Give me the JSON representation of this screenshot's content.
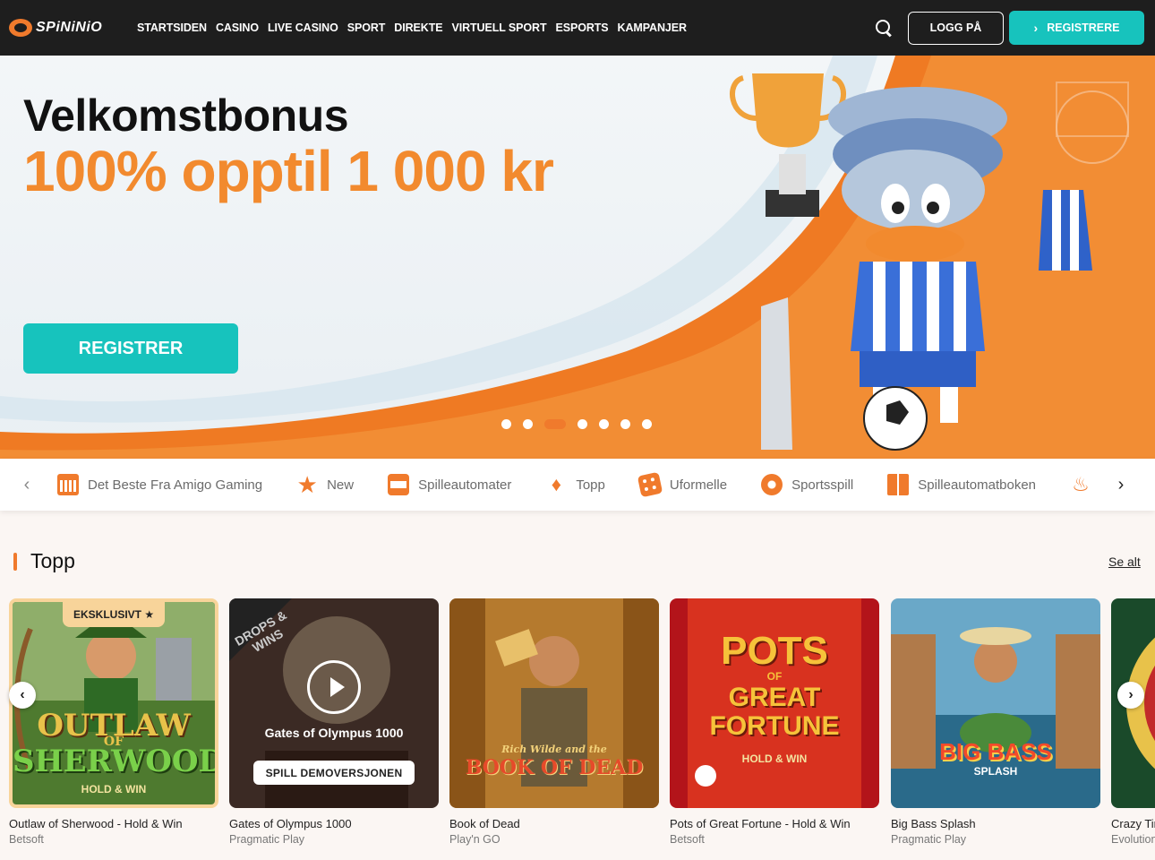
{
  "header": {
    "logo_text": "SPiNiNiO",
    "nav": [
      "STARTSIDEN",
      "CASINO",
      "LIVE CASINO",
      "SPORT",
      "DIREKTE",
      "VIRTUELL SPORT",
      "ESPORTS",
      "KAMPANJER"
    ],
    "login_label": "LOGG PÅ",
    "register_label": "REGISTRERE",
    "register_icon": "chevron-right-icon",
    "search_icon": "search-icon"
  },
  "hero": {
    "title": "Velkomstbonus",
    "subtitle": "100% opptil 1 000 kr",
    "cta_label": "REGISTRER",
    "slide_count": 7,
    "active_slide": 3
  },
  "categories": {
    "items": [
      {
        "label": "Det Beste Fra Amigo Gaming",
        "icon": "calendar-icon"
      },
      {
        "label": "New",
        "icon": "star-icon"
      },
      {
        "label": "Spilleautomater",
        "icon": "slot-machine-icon"
      },
      {
        "label": "Topp",
        "icon": "diamond-icon"
      },
      {
        "label": "Uformelle",
        "icon": "dice-icon"
      },
      {
        "label": "Sportsspill",
        "icon": "football-icon"
      },
      {
        "label": "Spilleautomatboken",
        "icon": "book-icon"
      },
      {
        "label": "",
        "icon": "fire-icon"
      }
    ]
  },
  "section": {
    "title": "Topp",
    "see_all": "Se alt"
  },
  "games": [
    {
      "name": "Outlaw of Sherwood - Hold & Win",
      "provider": "Betsoft",
      "badge": "EKSKLUSIVT ★",
      "thumb_line1": "OUTLAW",
      "thumb_line2": "OF",
      "thumb_line3": "SHERWOOD",
      "thumb_line4": "HOLD & WIN"
    },
    {
      "name": "Gates of Olympus 1000",
      "provider": "Pragmatic Play",
      "hover_title": "Gates of Olympus 1000",
      "demo_label": "SPILL DEMOVERSJONEN",
      "corner_text": "DROPS & WINS"
    },
    {
      "name": "Book of Dead",
      "provider": "Play'n GO",
      "thumb_line1": "Rich Wilde and the",
      "thumb_line2": "BOOK OF DEAD"
    },
    {
      "name": "Pots of Great Fortune - Hold & Win",
      "provider": "Betsoft",
      "thumb_line1": "POTS",
      "thumb_line2": "OF",
      "thumb_line3": "GREAT",
      "thumb_line4": "FORTUNE",
      "thumb_line5": "HOLD & WIN"
    },
    {
      "name": "Big Bass Splash",
      "provider": "Pragmatic Play",
      "thumb_line1": "BIG BASS",
      "thumb_line2": "SPLASH"
    },
    {
      "name": "Crazy Time",
      "provider": "Evolution"
    }
  ],
  "colors": {
    "accent_orange": "#f07a2c",
    "accent_teal": "#17c3bd",
    "header_bg": "#1e1e1e"
  }
}
